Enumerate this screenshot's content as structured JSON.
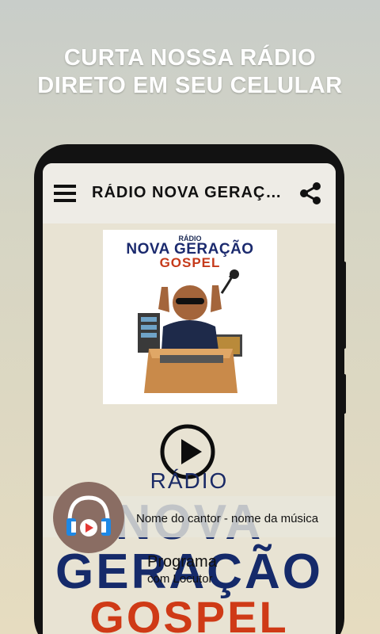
{
  "promo": {
    "line1": "CURTA NOSSA RÁDIO",
    "line2": "DIRETO EM SEU CELULAR"
  },
  "app": {
    "title": "RÁDIO NOVA GERAÇÃO GOSPEL",
    "menu_icon": "hamburger-menu-icon",
    "share_icon": "share-icon"
  },
  "cover": {
    "small": "RÁDIO",
    "big": "NOVA GERAÇÃO",
    "sub": "GOSPEL"
  },
  "player": {
    "play_icon": "play-icon",
    "now_playing": "Nome do cantor - nome da música",
    "program_title": "Programa",
    "program_host": "com Locutor",
    "avatar_icon": "headphones-icon"
  },
  "brand": {
    "radio": "RÁDIO",
    "line1": "NOVA",
    "line2": "GERAÇÃO",
    "line3": "GOSPEL"
  },
  "colors": {
    "brand_navy": "#152a6a",
    "brand_orange": "#cf3a16",
    "avatar_bg": "#8a6d63",
    "headphone_blue": "#1e88e5"
  }
}
